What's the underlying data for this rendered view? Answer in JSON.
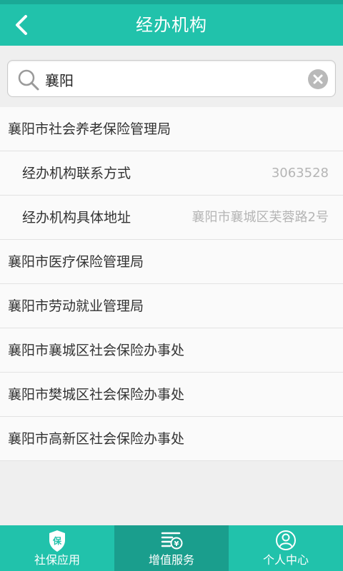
{
  "header": {
    "title": "经办机构",
    "back_icon": "back-arrow-icon"
  },
  "search": {
    "value": "襄阳",
    "icon": "search-icon",
    "clear_icon": "clear-icon"
  },
  "list": [
    {
      "label": "襄阳市社会养老保险管理局"
    },
    {
      "label": "经办机构联系方式",
      "value": "3063528"
    },
    {
      "label": "经办机构具体地址",
      "value": "襄阳市襄城区芙蓉路2号"
    },
    {
      "label": "襄阳市医疗保险管理局"
    },
    {
      "label": "襄阳市劳动就业管理局"
    },
    {
      "label": "襄阳市襄城区社会保险办事处"
    },
    {
      "label": "襄阳市樊城区社会保险办事处"
    },
    {
      "label": "襄阳市高新区社会保险办事处"
    }
  ],
  "tabbar": {
    "tabs": [
      {
        "label": "社保应用",
        "icon": "shield-icon"
      },
      {
        "label": "增值服务",
        "icon": "yen-card-icon"
      },
      {
        "label": "个人中心",
        "icon": "person-icon"
      }
    ],
    "active_index": 1
  },
  "colors": {
    "primary": "#21c2ab",
    "primary_dark": "#1a9e8d",
    "list_bg": "#fafafa",
    "page_bg": "#efefef"
  }
}
